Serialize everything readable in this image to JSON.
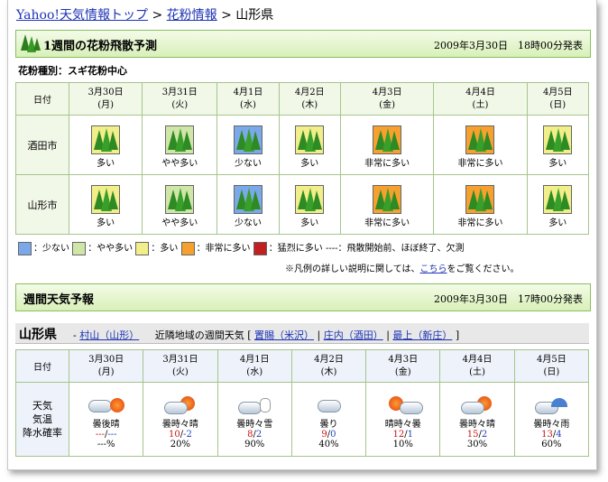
{
  "breadcrumb": {
    "home": "Yahoo!天気情報トップ",
    "sep1": " > ",
    "pollen": "花粉情報",
    "sep2": " > ",
    "current": "山形県"
  },
  "pollen_section": {
    "title": "1週間の花粉飛散予測",
    "issued": "2009年3月30日　18時00分発表",
    "type_label": "花粉種別：スギ花粉中心"
  },
  "pollen_table": {
    "date_header": "日付",
    "days": [
      {
        "date": "3月30日",
        "dow": "(月)"
      },
      {
        "date": "3月31日",
        "dow": "(火)"
      },
      {
        "date": "4月1日",
        "dow": "(水)"
      },
      {
        "date": "4月2日",
        "dow": "(木)"
      },
      {
        "date": "4月3日",
        "dow": "(金)"
      },
      {
        "date": "4月4日",
        "dow": "(土)"
      },
      {
        "date": "4月5日",
        "dow": "(日)"
      }
    ],
    "rows": [
      {
        "city": "酒田市",
        "levels": [
          "多い",
          "やや多い",
          "少ない",
          "多い",
          "非常に多い",
          "非常に多い",
          "多い"
        ],
        "codes": [
          3,
          2,
          1,
          3,
          4,
          4,
          3
        ]
      },
      {
        "city": "山形市",
        "levels": [
          "多い",
          "やや多い",
          "少ない",
          "多い",
          "非常に多い",
          "非常に多い",
          "多い"
        ],
        "codes": [
          3,
          2,
          1,
          3,
          4,
          4,
          3
        ]
      }
    ]
  },
  "legend": {
    "items": [
      "：少ない",
      "：やや多い",
      "：多い",
      "：非常に多い",
      "：猛烈に多い"
    ],
    "dash_text": "----：飛散開始前、ほぼ終了、欠測"
  },
  "note": {
    "prefix": "※凡例の詳しい説明に関しては、",
    "link": "こちら",
    "suffix": "をご覧ください。"
  },
  "weather_section": {
    "title": "週間天気予報",
    "issued": "2009年3月30日　17時00分発表"
  },
  "pref_bar": {
    "name": "山形県",
    "dash": " - ",
    "current_link": "村山（山形）",
    "nearby_label": "近隣地域の週間天気 [",
    "links": [
      "置賜（米沢）",
      "庄内（酒田）",
      "最上（新庄）"
    ],
    "sep": " | ",
    "close": " ]"
  },
  "weather_table": {
    "date_header": "日付",
    "row_labels": [
      "天気",
      "気温",
      "降水確率"
    ],
    "days": [
      {
        "date": "3月30日",
        "dow": "(月)",
        "icon": "cloudy-then-sunny-icon",
        "text": "曇後晴",
        "hi": "---",
        "slash": "/",
        "lo": "---",
        "pop": "---%"
      },
      {
        "date": "3月31日",
        "dow": "(火)",
        "icon": "cloudy-sometimes-sunny-icon",
        "text": "曇時々晴",
        "hi": "10",
        "slash": "/",
        "lo": "-2",
        "pop": "20%"
      },
      {
        "date": "4月1日",
        "dow": "(水)",
        "icon": "cloudy-sometimes-snow-icon",
        "text": "曇時々雪",
        "hi": "8",
        "slash": "/",
        "lo": "2",
        "pop": "90%"
      },
      {
        "date": "4月2日",
        "dow": "(木)",
        "icon": "cloudy-icon",
        "text": "曇り",
        "hi": "9",
        "slash": "/",
        "lo": "0",
        "pop": "40%"
      },
      {
        "date": "4月3日",
        "dow": "(金)",
        "icon": "sunny-sometimes-cloudy-icon",
        "text": "晴時々曇",
        "hi": "12",
        "slash": "/",
        "lo": "1",
        "pop": "10%"
      },
      {
        "date": "4月4日",
        "dow": "(土)",
        "icon": "cloudy-sometimes-sunny-icon",
        "text": "曇時々晴",
        "hi": "15",
        "slash": "/",
        "lo": "2",
        "pop": "30%"
      },
      {
        "date": "4月5日",
        "dow": "(日)",
        "icon": "cloudy-sometimes-rain-icon",
        "text": "曇時々雨",
        "hi": "13",
        "slash": "/",
        "lo": "4",
        "pop": "60%"
      }
    ]
  },
  "colors": {
    "section_border": "#88c060",
    "link": "#1c33b5",
    "high_temp": "#d01010",
    "low_temp": "#2040c0",
    "level1": "#7aa8e8",
    "level2": "#cfe6a8",
    "level3": "#f2ee8a",
    "level4": "#f6a030",
    "level5": "#c02020"
  }
}
